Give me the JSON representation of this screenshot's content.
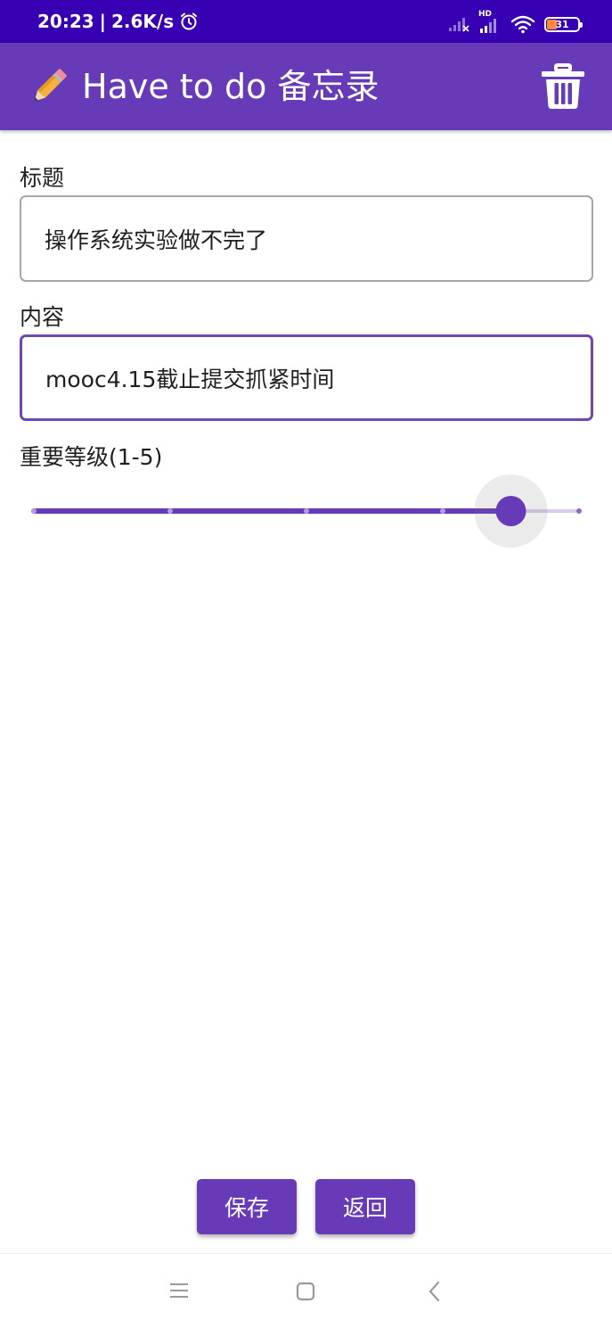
{
  "status_bar": {
    "time": "20:23",
    "separator": "|",
    "net_speed": "2.6K/s",
    "signal_label": "HD",
    "battery_percent": "31",
    "icons": [
      "alarm-icon",
      "signal-icon",
      "hd-signal-icon",
      "wifi-icon",
      "battery-icon"
    ]
  },
  "app_bar": {
    "icon": "pencil-icon",
    "title": "Have to do 备忘录",
    "action_icon": "trash-icon",
    "background_color": "#673ab7"
  },
  "form": {
    "title_label": "标题",
    "title_value": "操作系统实验做不完了",
    "content_label": "内容",
    "content_value": "mooc4.15截止提交抓紧时间",
    "level_label": "重要等级(1-5)",
    "level_min": 1,
    "level_max": 5,
    "level_value": 4.5
  },
  "buttons": {
    "save_label": "保存",
    "back_label": "返回"
  },
  "nav_bar": {
    "icons": [
      "menu-icon",
      "home-icon",
      "back-icon"
    ]
  },
  "colors": {
    "status_bar": "#3700b3",
    "primary": "#673ab7",
    "focus_border": "#6f47b5"
  }
}
